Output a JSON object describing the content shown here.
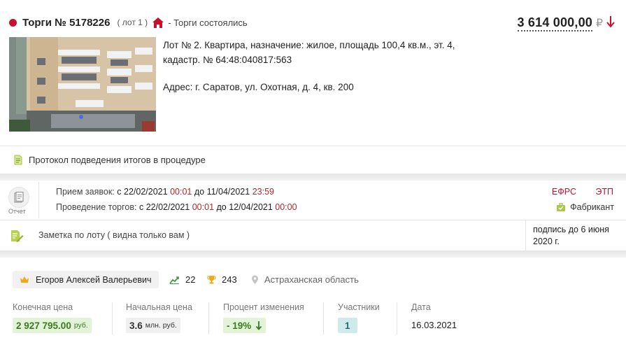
{
  "header": {
    "title": "Торги № 5178226",
    "lot": "( лот 1 )",
    "status": "- Торги состоялись",
    "price": "3 614 000,00",
    "currency": "₽",
    "colors": {
      "accent": "#c8102e",
      "green": "#3c7a22"
    }
  },
  "lot": {
    "description": "Лот № 2. Квартира, назначение: жилое, площадь 100,4 кв.м., эт. 4, кадастр. № 64:48:040817:563",
    "address": "Адрес: г. Саратов, ул. Охотная, д. 4, кв. 200",
    "protocol": "Протокол подведения итогов в процедуре"
  },
  "schedule": {
    "report_label": "Отчет",
    "applications": {
      "label": "Прием заявок:",
      "from_word": "с",
      "from_date": "22/02/2021",
      "from_time": "00:01",
      "to_word": "до",
      "to_date": "11/04/2021",
      "to_time": "23:59"
    },
    "auction": {
      "label": "Проведение торгов:",
      "from_word": "с",
      "from_date": "22/02/2021",
      "from_time": "00:01",
      "to_word": "до",
      "to_date": "12/04/2021",
      "to_time": "00:00"
    },
    "efrs": "ЕФРС",
    "etp": "ЭТП",
    "platform": "Фабрикант",
    "note": "Заметка по лоту ( видна только вам )",
    "signature": "подпись до 6 июня 2020 г."
  },
  "result": {
    "winner": "Егоров Алексей Валерьевич",
    "wins": "22",
    "trophies": "243",
    "region": "Астраханская область",
    "final_price_label": "Конечная цена",
    "final_price": "2 927 795.00",
    "final_price_unit": "руб.",
    "start_price_label": "Начальная цена",
    "start_price": "3.6",
    "start_price_unit": "млн. руб.",
    "change_label": "Процент изменения",
    "change": "- 19%",
    "participants_label": "Участники",
    "participants": "1",
    "date_label": "Дата",
    "date": "16.03.2021"
  }
}
